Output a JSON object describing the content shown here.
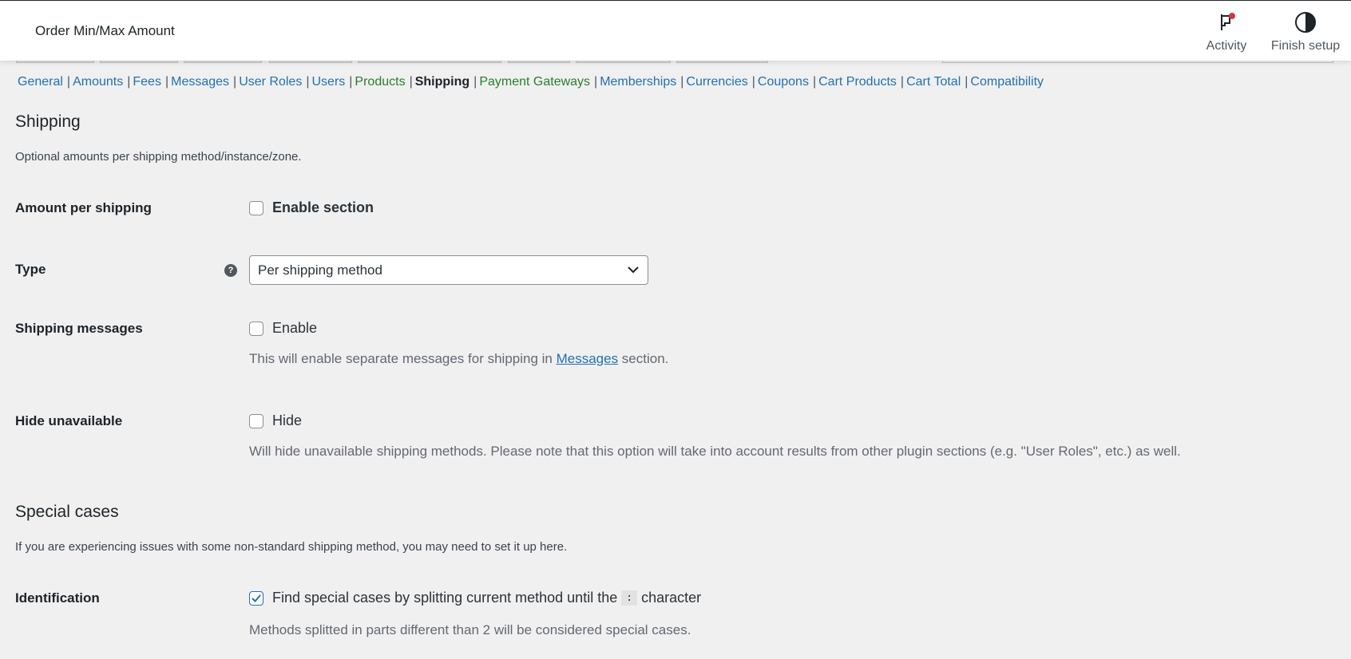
{
  "header": {
    "title": "Order Min/Max Amount",
    "activity_label": "Activity",
    "finish_setup_label": "Finish setup"
  },
  "subnav": [
    {
      "label": "General",
      "style": "link"
    },
    {
      "label": "Amounts",
      "style": "link"
    },
    {
      "label": "Fees",
      "style": "link"
    },
    {
      "label": "Messages",
      "style": "link"
    },
    {
      "label": "User Roles",
      "style": "link"
    },
    {
      "label": "Users",
      "style": "link"
    },
    {
      "label": "Products",
      "style": "green"
    },
    {
      "label": "Shipping",
      "style": "current"
    },
    {
      "label": "Payment Gateways",
      "style": "green"
    },
    {
      "label": "Memberships",
      "style": "link"
    },
    {
      "label": "Currencies",
      "style": "link"
    },
    {
      "label": "Coupons",
      "style": "link"
    },
    {
      "label": "Cart Products",
      "style": "link"
    },
    {
      "label": "Cart Total",
      "style": "link"
    },
    {
      "label": "Compatibility",
      "style": "link"
    }
  ],
  "subnav_separator": "|",
  "shipping": {
    "heading": "Shipping",
    "description": "Optional amounts per shipping method/instance/zone.",
    "amount_per_shipping": {
      "label": "Amount per shipping",
      "checkbox_label": "Enable section",
      "checked": false
    },
    "type": {
      "label": "Type",
      "help_icon_glyph": "?",
      "selected": "Per shipping method"
    },
    "shipping_messages": {
      "label": "Shipping messages",
      "checkbox_label": "Enable",
      "checked": false,
      "help_before": "This will enable separate messages for shipping in ",
      "help_link": "Messages",
      "help_after": " section."
    },
    "hide_unavailable": {
      "label": "Hide unavailable",
      "checkbox_label": "Hide",
      "checked": false,
      "help": "Will hide unavailable shipping methods. Please note that this option will take into account results from other plugin sections (e.g. \"User Roles\", etc.) as well."
    }
  },
  "special_cases": {
    "heading": "Special cases",
    "description": "If you are experiencing issues with some non-standard shipping method, you may need to set it up here.",
    "identification": {
      "label": "Identification",
      "checked": true,
      "text_before": "Find special cases by splitting current method until the",
      "code": ":",
      "text_after": "character",
      "help": "Methods splitted in parts different than 2 will be considered special cases."
    }
  },
  "colors": {
    "link": "#2271b1",
    "green_link": "#2a7d2a",
    "background": "#f0f0f1",
    "notification_dot": "#d63638"
  }
}
